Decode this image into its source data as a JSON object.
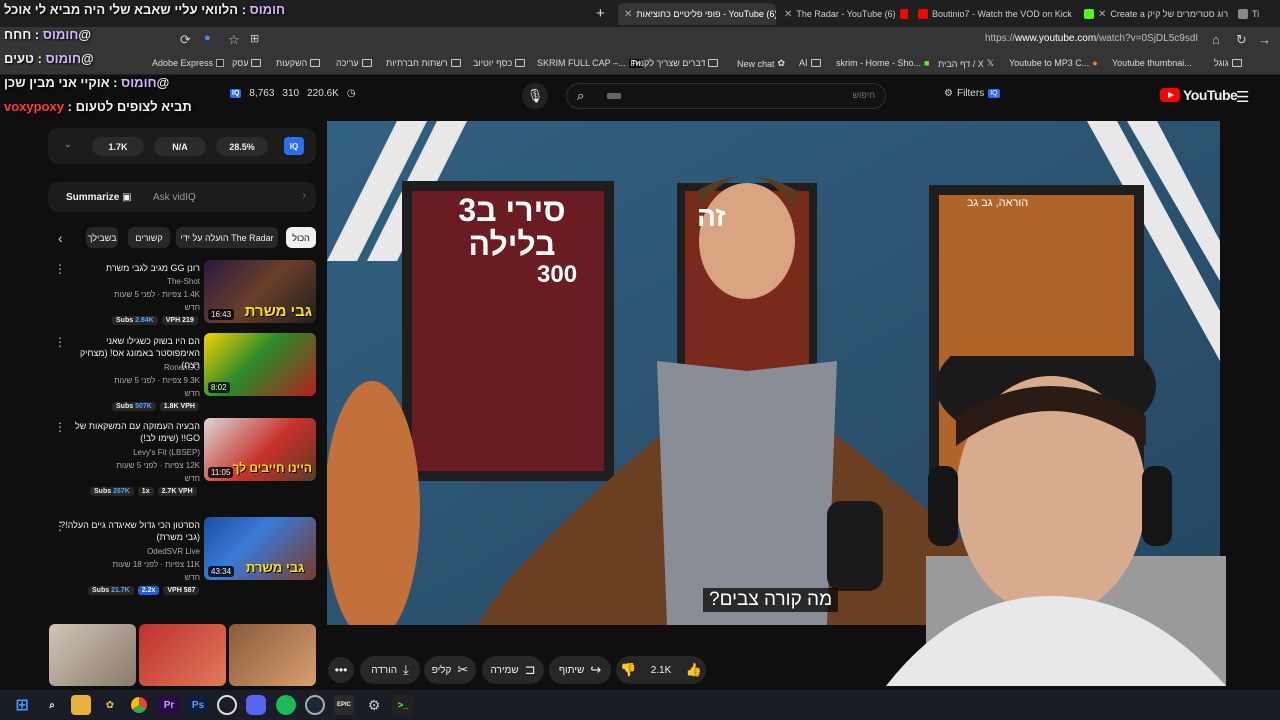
{
  "chat": [
    {
      "name": "חומוס",
      "text": ": הלוואי עליי שאבא שלי היה מביא לי אוכל"
    },
    {
      "name": "חומוס",
      "text": ": חחח@"
    },
    {
      "name": "חומוס",
      "text": ": טעים@"
    },
    {
      "name": "חומוס",
      "text": ": אוקיי אני מבין שכן@"
    },
    {
      "name": "voxypoxy",
      "text": ": תביא לצופים לטעום"
    }
  ],
  "browser": {
    "tabs": [
      {
        "label": "פופי פליטיים כחוציאות - YouTube (6)",
        "favicon": "yt"
      },
      {
        "label": "The Radar - YouTube (6)",
        "favicon": "yt"
      },
      {
        "label": "Boutinio7 - Watch the VOD on Kick",
        "favicon": "yt"
      },
      {
        "label": "Create a דירוג סטרימרים של קיק",
        "favicon": "kick"
      },
      {
        "label": "Ti",
        "favicon": "gray"
      }
    ],
    "url_prefix": "https://",
    "url_domain": "www.youtube.com",
    "url_path": "/watch?v=0SjDL5c9sdI",
    "bookmarks": [
      "Adobe Express",
      "עסק",
      "השקעות",
      "עריכה",
      "רשתות חברתיות",
      "כסף יוטיוב",
      "SKRIM FULL CAP –...",
      "דברים שצריך לקנות",
      "New chat",
      "AI",
      "skrim - Home - Sho...",
      "דף הבית / X",
      "Youtube to MP3 C...",
      "Youtube thumbnai...",
      "גוגל"
    ]
  },
  "header": {
    "stats": [
      "8,763",
      "310",
      "220.6K"
    ],
    "search_placeholder": "חיפוש",
    "filters_label": "Filters",
    "logo_text": "YouTube",
    "iq_label": "IQ"
  },
  "vidiq": {
    "stats": [
      "1.7K",
      "N/A",
      "28.5%"
    ],
    "badge": "IQ",
    "summarize_label": "Summarize",
    "ask_placeholder": "Ask vidIQ"
  },
  "chips": [
    "הכול",
    "הועלה על ידי The Radar",
    "קשורים",
    "בשבילך"
  ],
  "recommendations": [
    {
      "title": "רונן GG מגיב לגבי משרת",
      "channel": "The-Shot",
      "meta": "1.4K צפיות · לפני 5 שעות",
      "tag": "חדש",
      "duration": "16:43",
      "subs": "2.84K",
      "vph": "VPH 219"
    },
    {
      "title": "הם היו בשוק כשגילו שאני האימפוסטר באמונג אס! (מצחיק רצח)",
      "channel": "RonenGG",
      "meta": "9.3K צפיות · לפני 5 שעות",
      "tag": "חדש",
      "duration": "8:02",
      "subs": "507K",
      "vph": "1.8K VPH"
    },
    {
      "title": "הבעיה העמוקה עם המשקאות של GO!! (שימו לב!)",
      "channel": "Levy's Fit (LBSEP)",
      "meta": "12K צפיות · לפני 5 שעות",
      "tag": "חדש",
      "duration": "11:05",
      "subs": "267K",
      "mult": "1x",
      "vph": "2.7K VPH"
    },
    {
      "title": "הסרטון הכי גדול שאיגדה גיים העלה!? (גבי משרת)",
      "channel": "OdedSVR Live",
      "meta": "11K צפיות · לפני 18 שעות",
      "tag": "חדש",
      "duration": "43:34",
      "subs": "21.7K",
      "mult": "2.2x",
      "vph": "VPH 587"
    }
  ],
  "thumb_text": [
    "גבי משרת",
    "היינו חייבים לך",
    "גבי משרת"
  ],
  "video": {
    "subtitle": "מה קורה צבים?",
    "posters": [
      "סירי ב3 בלילה",
      "300",
      "זה",
      "הוראה, גב גב"
    ]
  },
  "actions": {
    "likes": "2.1K",
    "share": "שיתוף",
    "save": "שמירה",
    "clip": "קליפ",
    "download": "הורדה"
  },
  "taskbar": [
    "windows-icon",
    "search-icon",
    "folder-icon",
    "app-icon",
    "chrome-icon",
    "premiere-icon",
    "photoshop-icon",
    "obs-icon",
    "discord-icon",
    "spotify-icon",
    "steam-icon",
    "epic-icon",
    "settings-icon",
    "terminal-icon"
  ],
  "taskbar_labels": {
    "pr": "Pr",
    "ps": "Ps",
    "epic": "EPIC"
  }
}
